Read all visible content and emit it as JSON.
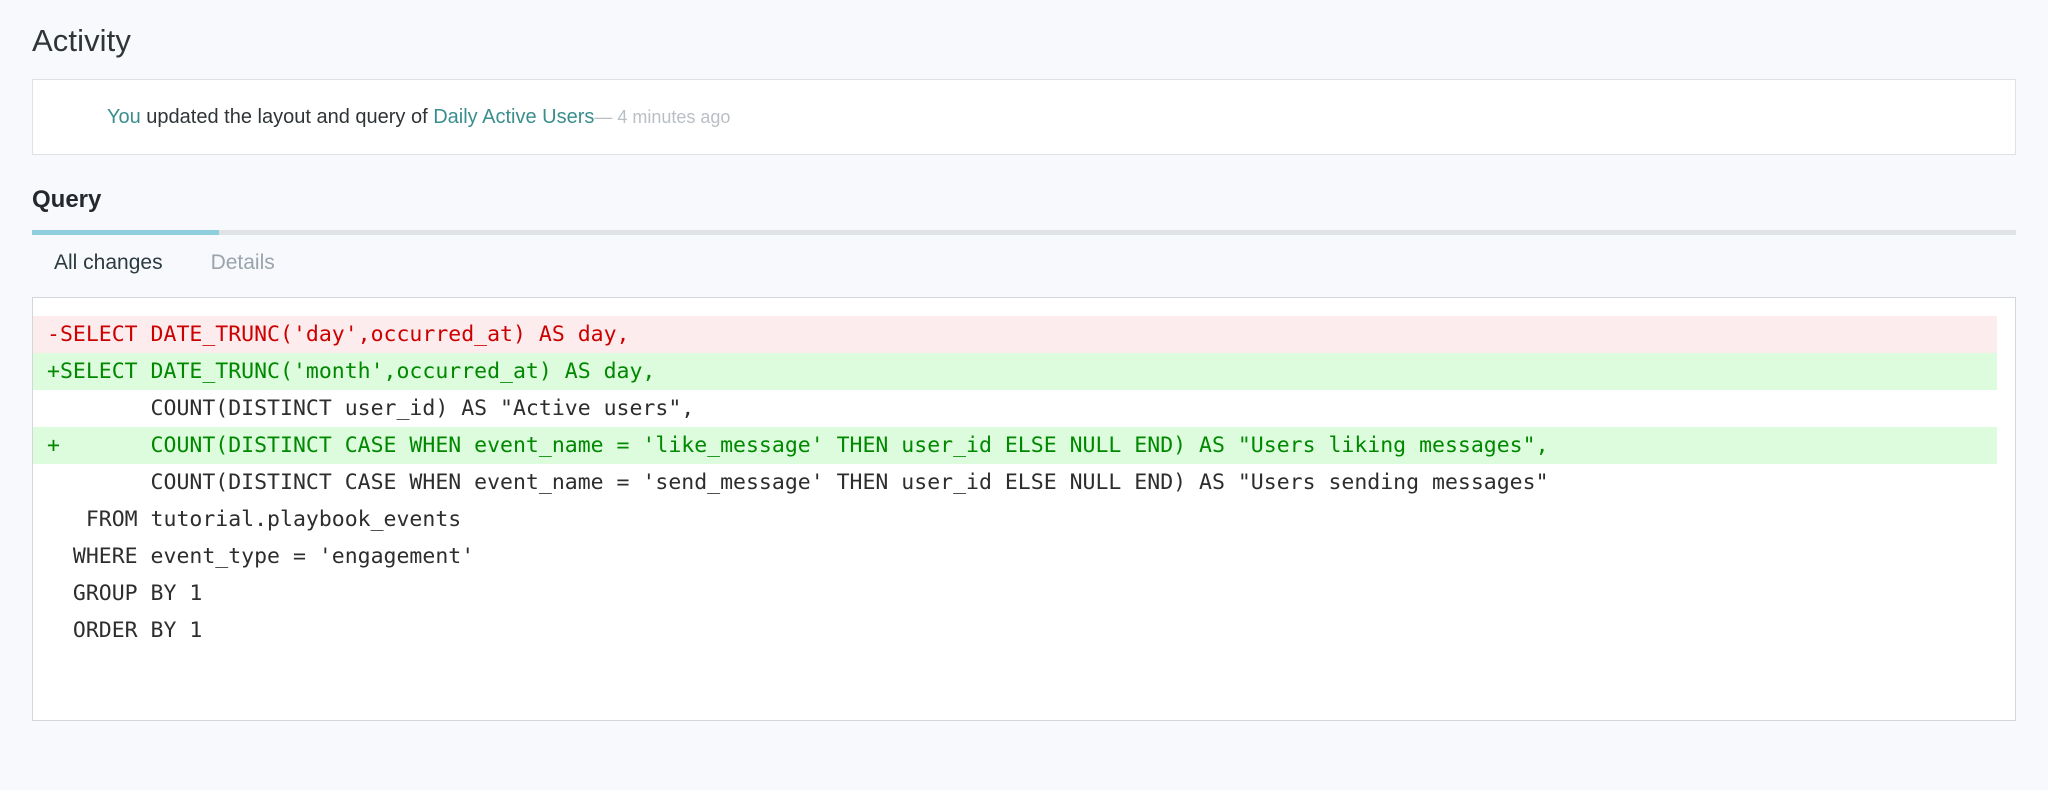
{
  "activity": {
    "heading": "Activity",
    "entry": {
      "actor": "You",
      "text": " updated the layout and query of ",
      "resource": "Daily Active Users",
      "meta": "— 4 minutes ago"
    }
  },
  "query": {
    "heading": "Query",
    "tabs": [
      {
        "label": "All changes",
        "active": true
      },
      {
        "label": "Details",
        "active": false
      }
    ],
    "diff": {
      "lines": [
        {
          "type": "removed",
          "text": "-SELECT DATE_TRUNC('day',occurred_at) AS day,"
        },
        {
          "type": "added",
          "text": "+SELECT DATE_TRUNC('month',occurred_at) AS day,"
        },
        {
          "type": "context",
          "text": "        COUNT(DISTINCT user_id) AS \"Active users\","
        },
        {
          "type": "added",
          "text": "+       COUNT(DISTINCT CASE WHEN event_name = 'like_message' THEN user_id ELSE NULL END) AS \"Users liking messages\","
        },
        {
          "type": "context",
          "text": "        COUNT(DISTINCT CASE WHEN event_name = 'send_message' THEN user_id ELSE NULL END) AS \"Users sending messages\""
        },
        {
          "type": "context",
          "text": "   FROM tutorial.playbook_events"
        },
        {
          "type": "context",
          "text": "  WHERE event_type = 'engagement'"
        },
        {
          "type": "context",
          "text": "  GROUP BY 1"
        },
        {
          "type": "context",
          "text": "  ORDER BY 1"
        }
      ]
    }
  },
  "colors": {
    "page_background": "#f8f9fc",
    "link": "#3b8e8e",
    "tab_active_underline": "#8fcedd",
    "tab_rule": "#dfe3e6",
    "diff_removed_bg": "#fdecee",
    "diff_removed_fg": "#cc0000",
    "diff_added_bg": "#ddfbdd",
    "diff_added_fg": "#008800"
  }
}
